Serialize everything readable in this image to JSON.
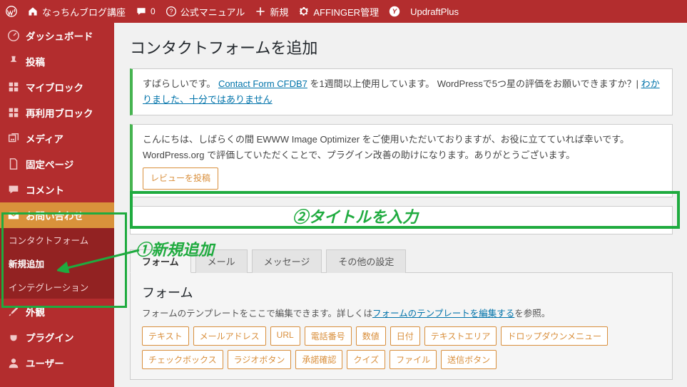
{
  "adminbar": {
    "site_name": "なっちんブログ講座",
    "comments": "0",
    "manual": "公式マニュアル",
    "new": "新規",
    "affinger": "AFFINGER管理",
    "updraft": "UpdraftPlus"
  },
  "sidebar": {
    "dashboard": "ダッシュボード",
    "posts": "投稿",
    "myblock": "マイブロック",
    "reusable": "再利用ブロック",
    "media": "メディア",
    "pages": "固定ページ",
    "comments": "コメント",
    "contact": "お問い合わせ",
    "submenu": {
      "forms": "コンタクトフォーム",
      "addnew": "新規追加",
      "integration": "インテグレーション"
    },
    "appearance": "外観",
    "plugins": "プラグイン",
    "users": "ユーザー"
  },
  "page": {
    "title": "コンタクトフォームを追加",
    "notice_cfdb7_pre": "すばらしいです。",
    "notice_cfdb7_link": "Contact Form CFDB7",
    "notice_cfdb7_post": " を1週間以上使用しています。 WordPressで5つ星の評価をお願いできますか？| ",
    "notice_cfdb7_link2": "わかりました、十分ではありません",
    "notice_ewww_l1": "こんにちは、しばらくの間 EWWW Image Optimizer をご使用いただいておりますが、お役に立てていれば幸いです。",
    "notice_ewww_l2": "WordPress.org で評価していただくことで、プラグイン改善の助けになります。ありがとうございます。",
    "review_btn": "レビューを投稿",
    "title_input_value": "",
    "tabs": {
      "form": "フォーム",
      "mail": "メール",
      "message": "メッセージ",
      "other": "その他の設定"
    },
    "form_panel": {
      "heading": "フォーム",
      "desc_pre": "フォームのテンプレートをここで編集できます。詳しくは",
      "desc_link": "フォームのテンプレートを編集する",
      "desc_post": "を参照。",
      "tags": [
        "テキスト",
        "メールアドレス",
        "URL",
        "電話番号",
        "数値",
        "日付",
        "テキストエリア",
        "ドロップダウンメニュー",
        "チェックボックス",
        "ラジオボタン",
        "承諾確認",
        "クイズ",
        "ファイル",
        "送信ボタン"
      ]
    }
  },
  "annotations": {
    "anno1": "①新規追加",
    "anno2": "②タイトルを入力"
  }
}
